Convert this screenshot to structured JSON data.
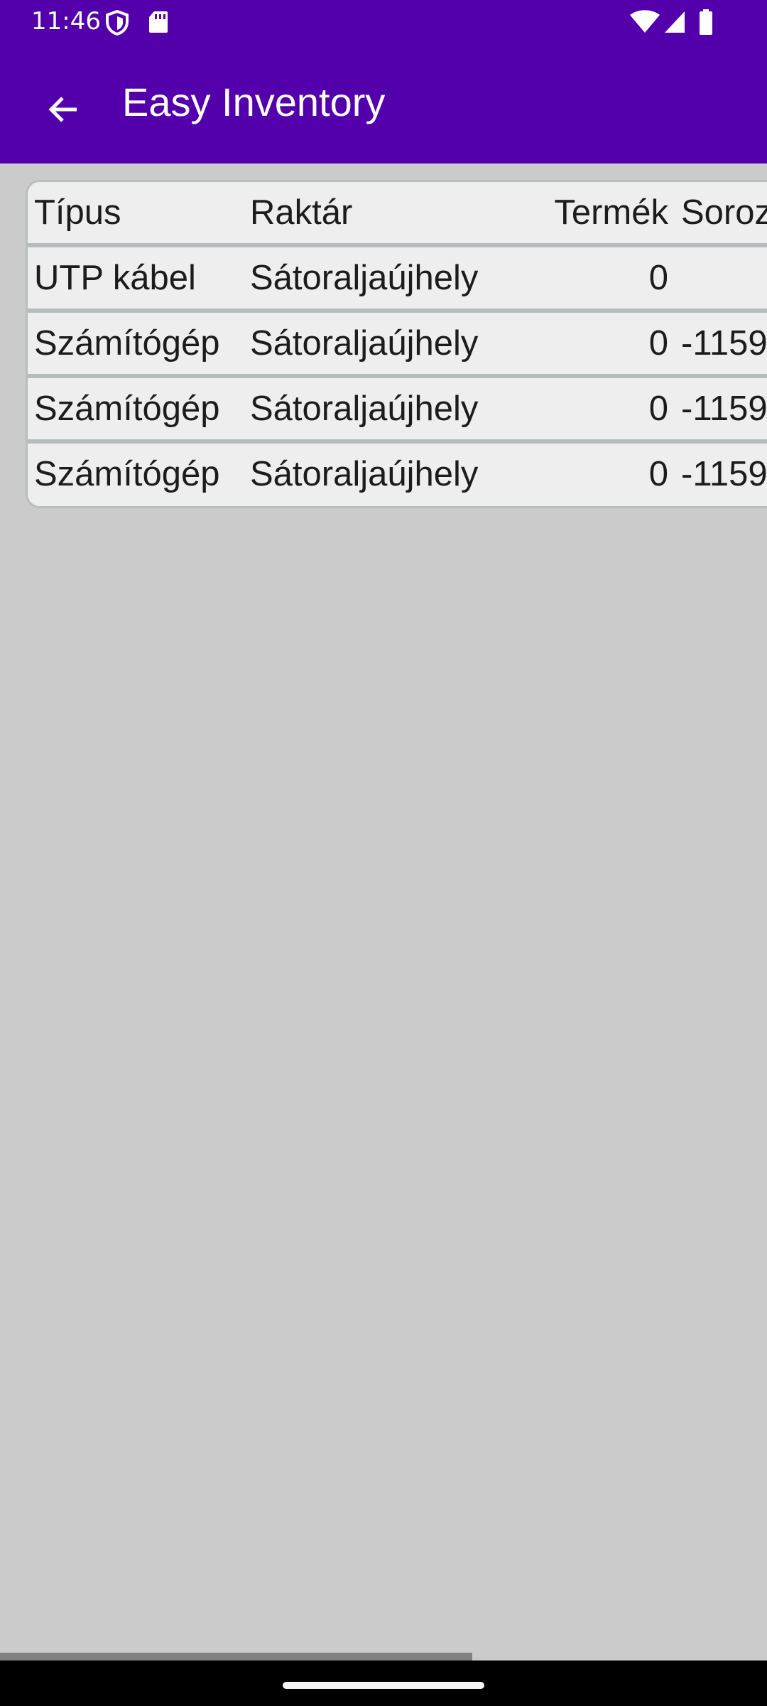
{
  "status_bar": {
    "time": "11:46",
    "left_icons": [
      "shield-icon",
      "sd-card-icon"
    ],
    "right_icons": [
      "wifi-icon",
      "cellular-signal-icon",
      "battery-icon"
    ]
  },
  "app_bar": {
    "title": "Easy Inventory",
    "back_icon": "arrow-back-icon",
    "background_color": "#5300ac"
  },
  "table": {
    "headers": [
      "Típus",
      "Raktár",
      "Termék",
      "Soroz"
    ],
    "rows": [
      [
        "UTP kábel",
        "Sátoraljaújhely",
        "0",
        ""
      ],
      [
        "Számítógép",
        "Sátoraljaújhely",
        "0",
        "-1159"
      ],
      [
        "Számítógép",
        "Sátoraljaújhely",
        "0",
        "-1159"
      ],
      [
        "Számítógép",
        "Sátoraljaújhely",
        "0",
        "-1159"
      ]
    ]
  },
  "scrollbar": {
    "horizontal_position": 0,
    "horizontal_visible_fraction": 0.62
  }
}
